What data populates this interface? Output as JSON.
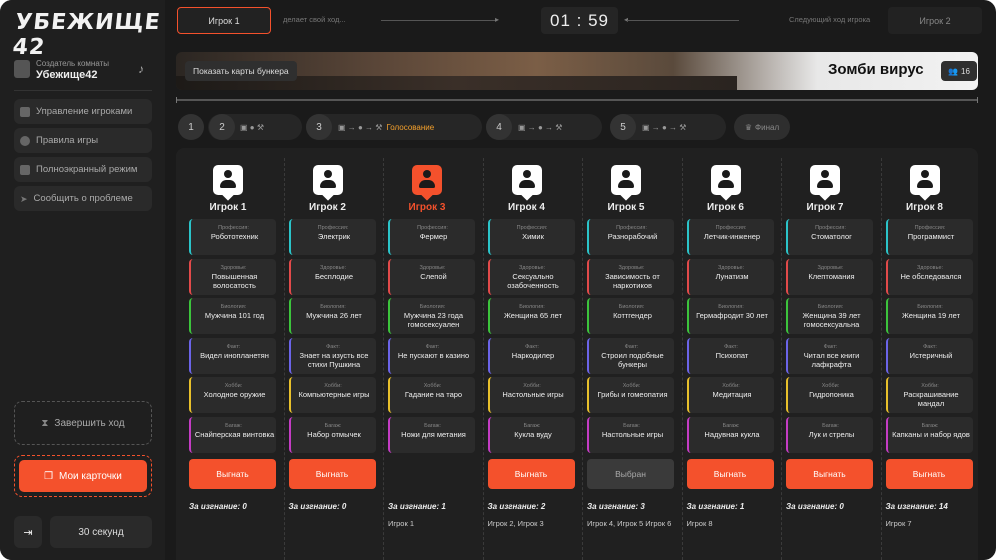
{
  "logo": "УБЕЖИЩЕ 42",
  "creator": {
    "label": "Создатель комнаты",
    "name": "Убежище42"
  },
  "menu": [
    "Управление игроками",
    "Правила игры",
    "Полноэкранный режим",
    "Сообщить о проблеме"
  ],
  "end_turn": "Завершить ход",
  "my_cards": "Мои карточки",
  "timer_setting": "30 секунд",
  "top": {
    "current_player": "Игрок 1",
    "making_move": "делает свой ход...",
    "timer": "01 : 59",
    "next_label": "Следующий ход игрока",
    "next_player": "Игрок 2"
  },
  "banner": {
    "show_cards": "Показать карты бункера",
    "bunker_name": "Зомби вирус",
    "count": "16"
  },
  "stages": [
    {
      "num": "1"
    },
    {
      "num": "2",
      "icons": "▣ ● ⚒"
    },
    {
      "num": "3",
      "icons": "▣ → ● → ⚒",
      "active": "Голосование"
    },
    {
      "num": "4",
      "icons": "▣ → ● → ⚒"
    },
    {
      "num": "5",
      "icons": "▣ → ● → ⚒"
    }
  ],
  "final": "Финал",
  "card_labels": [
    "Профессия:",
    "Здоровье:",
    "Биология:",
    "Факт:",
    "Хобби:",
    "Багаж:"
  ],
  "players": [
    {
      "name": "Игрок 1",
      "cards": [
        "Робототехник",
        "Повышенная волосатость",
        "Мужчина 101 год",
        "Видел инопланетян",
        "Холодное оружие",
        "Снайперская винтовка"
      ],
      "btn": "Выгнать",
      "votes_label": "За изгнание: 0",
      "voters": ""
    },
    {
      "name": "Игрок 2",
      "cards": [
        "Электрик",
        "Бесплодие",
        "Мужчина 26 лет",
        "Знает на изусть все стихи Пушкина",
        "Компьютерные игры",
        "Набор отмычек"
      ],
      "btn": "Выгнать",
      "votes_label": "За изгнание: 0",
      "voters": ""
    },
    {
      "name": "Игрок 3",
      "cards": [
        "Фермер",
        "Слепой",
        "Мужчина 23 года гомосексуален",
        "Не пускают в казино",
        "Гадание на таро",
        "Ножи для метания"
      ],
      "btn": "",
      "votes_label": "За изгнание: 1",
      "voters": "Игрок 1"
    },
    {
      "name": "Игрок 4",
      "cards": [
        "Химик",
        "Сексуально озабоченность",
        "Женщина 65 лет",
        "Наркодилер",
        "Настольные игры",
        "Кукла вуду"
      ],
      "btn": "Выгнать",
      "votes_label": "За изгнание: 2",
      "voters": "Игрок 2, Игрок 3"
    },
    {
      "name": "Игрок 5",
      "cards": [
        "Разнорабочий",
        "Зависимость от наркотиков",
        "Коттгендер",
        "Строил подобные бункеры",
        "Грибы и гомеопатия",
        "Настольные игры"
      ],
      "btn": "Выбран",
      "votes_label": "За изгнание: 3",
      "voters": "Игрок 4, Игрок 5 Игрок 6"
    },
    {
      "name": "Игрок 6",
      "cards": [
        "Летчик-инженер",
        "Лунатизм",
        "Гермафродит 30 лет",
        "Психопат",
        "Медитация",
        "Надувная кукла"
      ],
      "btn": "Выгнать",
      "votes_label": "За изгнание: 1",
      "voters": "Игрок 8"
    },
    {
      "name": "Игрок 7",
      "cards": [
        "Стоматолог",
        "Клептомания",
        "Женщина 39 лет гомосексуальна",
        "Читал все книги лафкрафта",
        "Гидропоника",
        "Лук и стрелы"
      ],
      "btn": "Выгнать",
      "votes_label": "За изгнание: 0",
      "voters": ""
    },
    {
      "name": "Игрок 8",
      "cards": [
        "Программист",
        "Не обследовался",
        "Женщина 19 лет",
        "Истеричный",
        "Раскрашивание мандал",
        "Капканы и набор ядов"
      ],
      "btn": "Выгнать",
      "votes_label": "За изгнание: 14",
      "voters": "Игрок 7"
    }
  ],
  "colors": {
    "accent": "#f4512c",
    "card_borders": [
      "#2bc4c9",
      "#e24a4a",
      "#3cc43c",
      "#6b64e8",
      "#e8c02b",
      "#c43cc4"
    ]
  }
}
